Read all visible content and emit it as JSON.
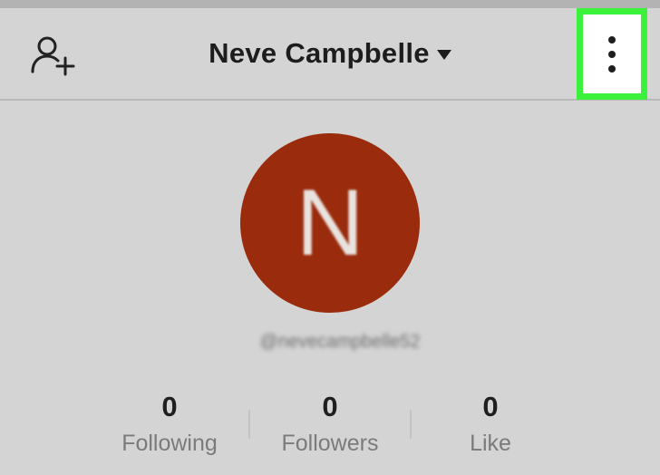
{
  "profile": {
    "name": "Neve Campbelle",
    "avatar_letter": "N",
    "username": "@nevecampbelle52"
  },
  "stats": [
    {
      "value": "0",
      "label": "Following"
    },
    {
      "value": "0",
      "label": "Followers"
    },
    {
      "value": "0",
      "label": "Like"
    }
  ],
  "icons": {
    "add_user": "add-user-icon",
    "dropdown": "caret-down-icon",
    "more": "vertical-dots-icon"
  },
  "colors": {
    "avatar_bg": "#9a2b0c",
    "highlight": "#3cf13c",
    "background": "#d4d4d4"
  }
}
